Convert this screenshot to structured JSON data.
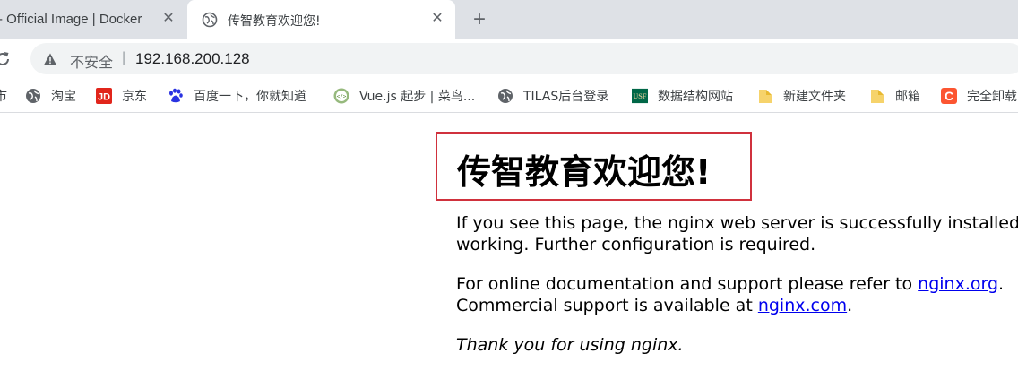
{
  "tabs": [
    {
      "title": "- Official Image | Docker",
      "close_glyph": "✕",
      "active": false
    },
    {
      "title": "传智教育欢迎您!",
      "close_glyph": "✕",
      "active": true
    }
  ],
  "new_tab_glyph": "+",
  "address_bar": {
    "security_label": "不安全",
    "separator": "|",
    "url": "192.168.200.128"
  },
  "bookmarks": [
    {
      "label": "市",
      "icon": "partial-icon"
    },
    {
      "label": "淘宝",
      "icon": "globe-icon"
    },
    {
      "label": "京东",
      "icon": "jd-icon"
    },
    {
      "label": "百度一下，你就知道",
      "icon": "baidu-paw-icon"
    },
    {
      "label": "Vue.js 起步 | 菜鸟...",
      "icon": "runoob-icon"
    },
    {
      "label": "TILAS后台登录",
      "icon": "globe-icon"
    },
    {
      "label": "数据结构网站",
      "icon": "usf-icon"
    },
    {
      "label": "新建文件夹",
      "icon": "folder-icon"
    },
    {
      "label": "邮箱",
      "icon": "folder-icon"
    },
    {
      "label": "完全卸载",
      "icon": "csdn-icon"
    }
  ],
  "page": {
    "heading": "传智教育欢迎您!",
    "para1_line1": "If you see this page, the nginx web server is successfully installed and",
    "para1_line2": "working. Further configuration is required.",
    "para2_text1": "For online documentation and support please refer to ",
    "para2_link1": "nginx.org",
    "para2_text2": ".",
    "para2_text3": "Commercial support is available at ",
    "para2_link2": "nginx.com",
    "para2_text4": ".",
    "para3": "Thank you for using nginx."
  },
  "colors": {
    "tabstrip_bg": "#dee1e6",
    "omnibox_bg": "#f1f3f4",
    "heading_border": "#d0313d",
    "link": "#0000ee"
  }
}
